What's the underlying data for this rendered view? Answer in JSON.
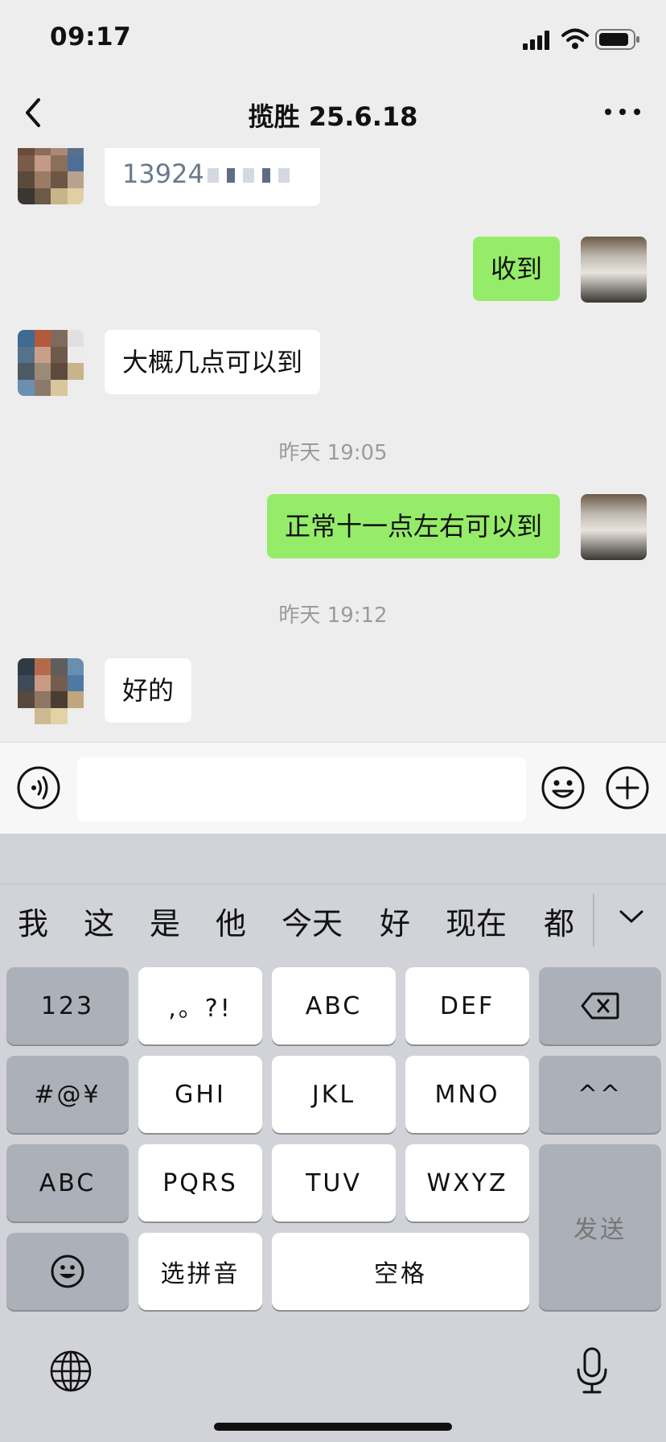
{
  "status_bar": {
    "time": "09:17"
  },
  "header": {
    "title": "揽胜 25.6.18"
  },
  "messages": [
    {
      "type": "in",
      "text": "13924"
    },
    {
      "type": "out",
      "text": "收到"
    },
    {
      "type": "in",
      "text": "大概几点可以到"
    },
    {
      "type": "time",
      "text": "昨天 19:05"
    },
    {
      "type": "out",
      "text": "正常十一点左右可以到"
    },
    {
      "type": "time",
      "text": "昨天 19:12"
    },
    {
      "type": "in",
      "text": "好的"
    }
  ],
  "input": {
    "value": ""
  },
  "keyboard": {
    "candidates": [
      "我",
      "这",
      "是",
      "他",
      "今天",
      "好",
      "现在",
      "都"
    ],
    "keys": {
      "k123": "123",
      "punct": ",。?!",
      "abc": "ABC",
      "def": "DEF",
      "symbols": "#@¥",
      "ghi": "GHI",
      "jkl": "JKL",
      "mno": "MNO",
      "face": "^^",
      "abc_switch": "ABC",
      "pqrs": "PQRS",
      "tuv": "TUV",
      "wxyz": "WXYZ",
      "send": "发送",
      "pinyin": "选拼音",
      "space": "空格"
    }
  },
  "icons": {
    "back": "chevron-left-icon",
    "more": "ellipsis-icon",
    "voice": "voice-icon",
    "emoji": "smiley-icon",
    "plus": "plus-circle-icon",
    "delete": "backspace-icon",
    "globe": "globe-icon",
    "mic": "microphone-icon"
  },
  "colors": {
    "outgoing_bubble": "#95ec69",
    "incoming_bubble": "#ffffff",
    "background": "#ededed"
  }
}
